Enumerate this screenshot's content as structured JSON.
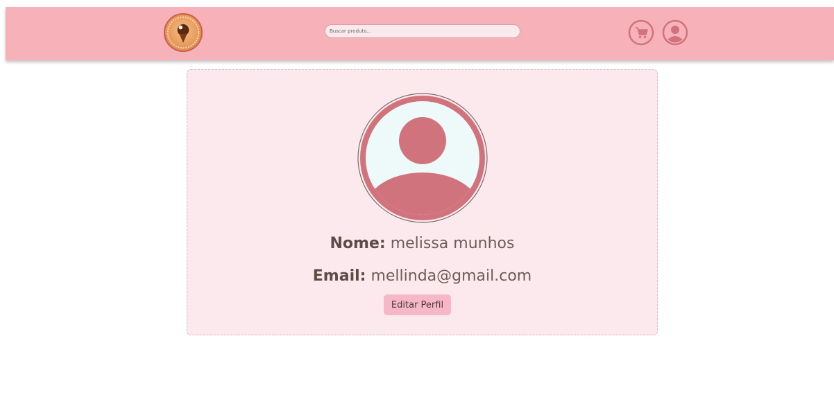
{
  "header": {
    "search": {
      "placeholder": "Buscar produto...",
      "value": ""
    },
    "logo_icon": "bakery-logo-icon",
    "cart_icon": "cart-icon",
    "user_icon": "user-icon"
  },
  "profile": {
    "avatar_icon": "user-avatar-icon",
    "name_label": "Nome:",
    "name_value": "melissa munhos",
    "email_label": "Email:",
    "email_value": "mellinda@gmail.com",
    "edit_button_label": "Editar Perfil"
  },
  "colors": {
    "header_bg": "#f7b1b9",
    "card_bg": "#fce9ee",
    "accent": "#d0737d",
    "button_bg": "#f6b8c8"
  }
}
